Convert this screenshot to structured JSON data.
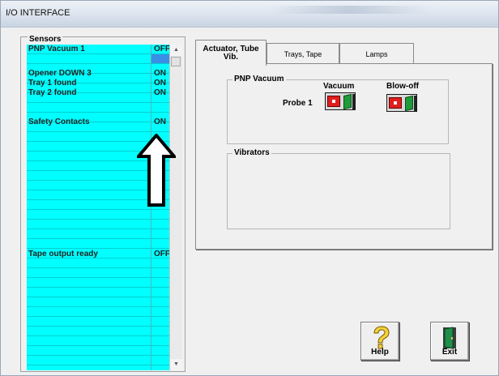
{
  "window": {
    "title": "I/O INTERFACE"
  },
  "sensors": {
    "group_label": "Sensors",
    "rows": [
      {
        "name": "PNP Vacuum 1",
        "value": "OFF"
      },
      {
        "name": "Opener DOWN 3",
        "value": "ON"
      },
      {
        "name": "Tray 1 found",
        "value": "ON"
      },
      {
        "name": "Tray 2 found",
        "value": "ON"
      },
      {
        "name": "Safety Contacts",
        "value": "ON"
      },
      {
        "name": "Tape output ready",
        "value": "OFF"
      }
    ]
  },
  "tabs": [
    {
      "label": "Actuator, Tube Vib.",
      "active": true
    },
    {
      "label": "Trays, Tape",
      "active": false
    },
    {
      "label": "Lamps",
      "active": false
    }
  ],
  "actuator_tab": {
    "pnp_vacuum_group": "PNP Vacuum",
    "col_vacuum": "Vacuum",
    "col_blowoff": "Blow-off",
    "probe_label": "Probe 1",
    "vibrators_group": "Vibrators"
  },
  "buttons": {
    "help": "Help",
    "exit": "Exit"
  },
  "icons": [
    "up-arrow-icon",
    "valve-icon",
    "question-mark-icon",
    "exit-door-icon"
  ],
  "colors": {
    "sensor_bg": "#00ffff",
    "selection": "#3a8ee6",
    "valve_red": "#e01e1e",
    "valve_green": "#1f9a3a"
  }
}
